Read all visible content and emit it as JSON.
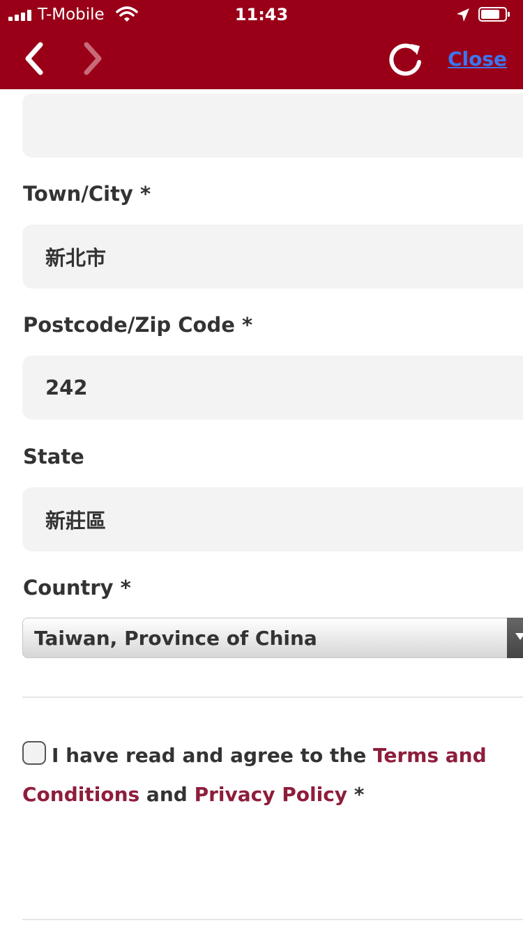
{
  "status_bar": {
    "carrier": "T-Mobile",
    "time": "11:43"
  },
  "nav": {
    "close_label": "Close"
  },
  "form": {
    "town_label": "Town/City *",
    "town_value": "新北市",
    "postcode_label": "Postcode/Zip Code *",
    "postcode_value": "242",
    "state_label": "State",
    "state_value": "新莊區",
    "country_label": "Country *",
    "country_value": "Taiwan, Province of China"
  },
  "agreement": {
    "text_before": "I have read and agree to the ",
    "terms_link": "Terms and Conditions",
    "and_text": " and ",
    "privacy_link": "Privacy Policy",
    "required_mark": " *",
    "checked": false
  },
  "colors": {
    "topbar": "#990018",
    "link": "#8e1d3b",
    "close_link": "#3b76f0",
    "field_bg": "#f3f3f3"
  }
}
